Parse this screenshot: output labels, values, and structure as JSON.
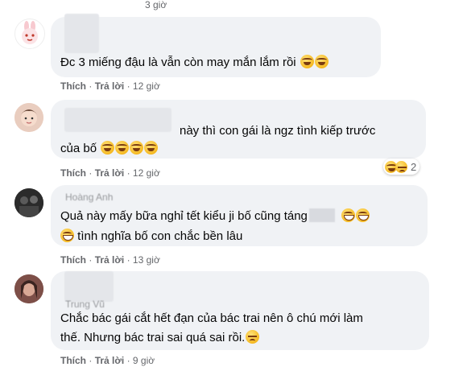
{
  "top_time": "3 giờ",
  "comments": [
    {
      "name": "",
      "lines": [
        "Đc 3 miếng đậu là vẫn còn may mắn lắm rồi"
      ],
      "like": "Thích",
      "reply": "Trả lời",
      "time": "12 giờ",
      "emoji_icons": [
        "rofl-emoji",
        "rofl-emoji"
      ]
    },
    {
      "name": "",
      "lines": [
        "này thì con gái là ngz tình kiếp trước",
        "của bố"
      ],
      "like": "Thích",
      "reply": "Trả lời",
      "time": "12 giờ",
      "emoji_icons": [
        "rofl-emoji",
        "rofl-emoji",
        "rofl-emoji",
        "rofl-emoji"
      ],
      "reaction_count": "2"
    },
    {
      "name": "Hoàng Anh",
      "lines": [
        "Quả này mấy bữa nghỉ tết kiểu ji bố cũng táng",
        "tình nghĩa bố con chắc bền lâu"
      ],
      "like": "Thích",
      "reply": "Trả lời",
      "time": "13 giờ",
      "emoji_icons": [
        "grin-emoji",
        "grin-emoji",
        "grin-emoji"
      ]
    },
    {
      "name": "Trung Vũ",
      "lines": [
        "Chắc bác gái cắt hết đạn của bác trai nên ô chú mới làm",
        "thế. Nhưng bác trai sai quá sai rồi."
      ],
      "like": "Thích",
      "reply": "Trả lời",
      "time": "9 giờ",
      "emoji_icons": [
        "sad-emoji"
      ]
    }
  ],
  "separator": "·",
  "colors": {
    "bubble": "#f0f2f5",
    "meta": "#65676b",
    "text": "#050505"
  }
}
